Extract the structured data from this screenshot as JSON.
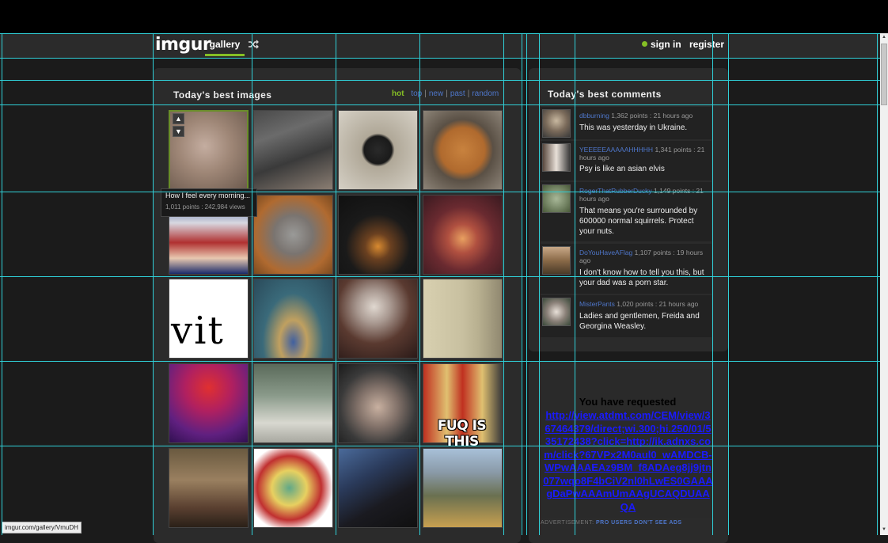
{
  "header": {
    "logo": "imgur",
    "nav_gallery": "gallery",
    "sign_in": "sign in",
    "register": "register"
  },
  "gallery": {
    "title": "Today's best images",
    "sort": [
      "hot",
      "top",
      "new",
      "past",
      "random"
    ],
    "tooltip_title": "How I feel every morning...",
    "tooltip_stats": "1,011 points : 242,984 views",
    "vit_text": "vit",
    "meme_text": "FUQ IS THIS"
  },
  "comments": {
    "title": "Today's best comments",
    "items": [
      {
        "user": "dbburning",
        "meta": "1,362 points : 21 hours ago",
        "text": "This was yesterday in Ukraine."
      },
      {
        "user": "YEEEEEAAAAAHHHHH",
        "meta": "1,341 points : 21 hours ago",
        "text": "Psy is like an asian elvis"
      },
      {
        "user": "RogerThatRubberDucky",
        "meta": "1,149 points : 21 hours ago",
        "text": "That means you're surrounded by 600000 normal squirrels. Protect your nuts."
      },
      {
        "user": "DoYouHaveAFlag",
        "meta": "1,107 points : 19 hours ago",
        "text": "I don't know how to tell you this, but your dad was a porn star."
      },
      {
        "user": "MisterPants",
        "meta": "1,020 points : 21 hours ago",
        "text": "Ladies and gentlemen, Freida and Georgina Weasley."
      }
    ]
  },
  "ad": {
    "heading": "You have requested",
    "url": "http://view.atdmt.com/CEM/view/367464379/direct;wi.300;hi.250/01/535172438?click=http://ik.adnxs.com/click?67VPx2M0aul0_wAMDCB-WPwAAAEAz9BM_f8ADAeg8jj9jtn077wqo8F4bCiV2nl0hLwES0GAAAgDaPwAAAmUmAAgUCAQDUAAQA",
    "note": "ADVERTISEMENT:",
    "note_link": "PRO USERS DON'T SEE ADS"
  },
  "status_bar": "imgur.com/gallery/VmuDH"
}
